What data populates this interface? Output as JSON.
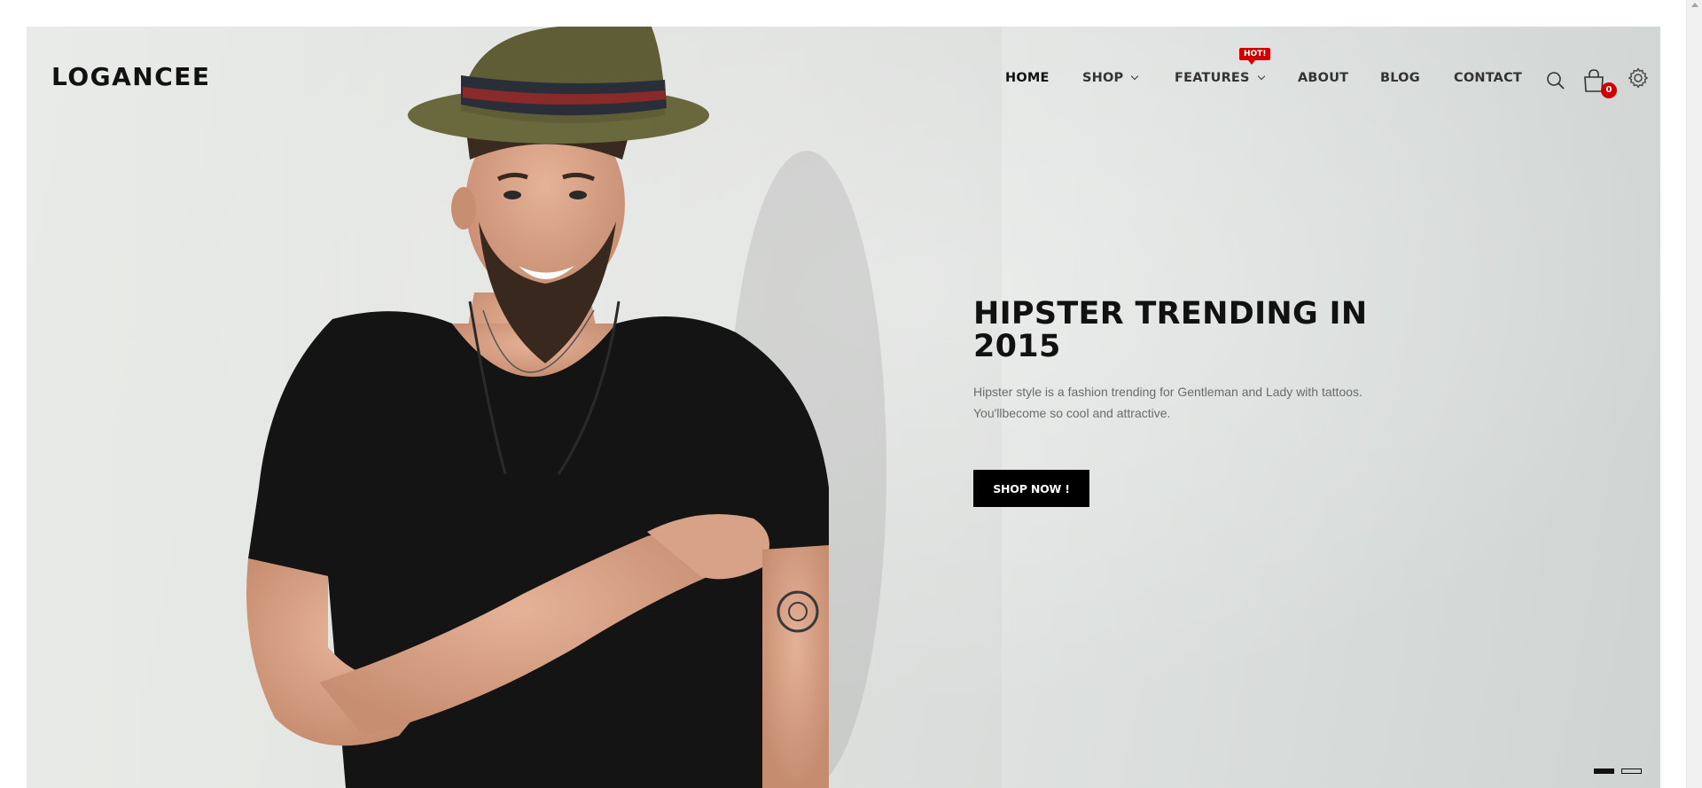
{
  "brand": {
    "logo_text": "LOGANCEE"
  },
  "nav": {
    "items": [
      {
        "label": "HOME",
        "active": true,
        "dropdown": false
      },
      {
        "label": "SHOP",
        "active": false,
        "dropdown": true
      },
      {
        "label": "FEATURES",
        "active": false,
        "dropdown": true,
        "badge": "HOT!"
      },
      {
        "label": "ABOUT",
        "active": false,
        "dropdown": false
      },
      {
        "label": "BLOG",
        "active": false,
        "dropdown": false
      },
      {
        "label": "CONTACT",
        "active": false,
        "dropdown": false
      }
    ]
  },
  "header_icons": {
    "search": "search-icon",
    "cart": "shopping-bag-icon",
    "cart_count": "0",
    "settings": "gear-icon"
  },
  "slide": {
    "title": "HIPSTER TRENDING IN 2015",
    "description": "Hipster style is a fashion trending for Gentleman and Lady with tattoos. You'llbecome so cool and attractive.",
    "cta_label": "SHOP NOW !"
  },
  "slider": {
    "total_slides": 2,
    "active_slide": 1
  },
  "colors": {
    "accent": "#d10000",
    "button_bg": "#000000",
    "text_dark": "#111111",
    "text_muted": "#6b6b6b"
  }
}
